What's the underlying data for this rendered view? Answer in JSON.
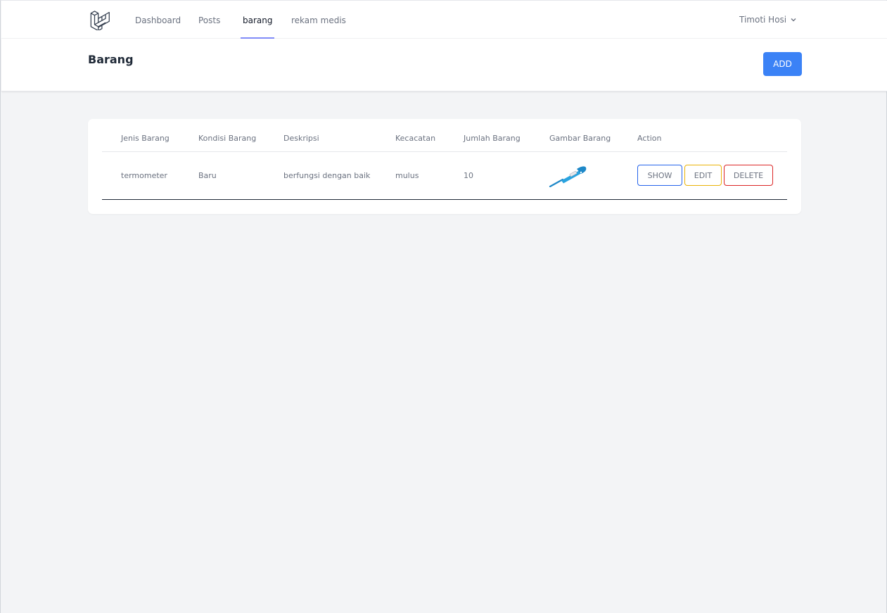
{
  "nav": {
    "logo_icon": "laravel-logo-icon",
    "links": [
      {
        "label": "Dashboard",
        "active": false
      },
      {
        "label": "Posts",
        "active": false
      },
      {
        "label": "barang",
        "active": true
      },
      {
        "label": "rekam medis",
        "active": false
      }
    ],
    "user_name": "Timoti Hosi",
    "user_menu_icon": "chevron-down-icon"
  },
  "header": {
    "title": "Barang",
    "add_label": "ADD"
  },
  "table": {
    "columns": [
      "Jenis Barang",
      "Kondisi Barang",
      "Deskripsi",
      "Kecacatan",
      "Jumlah Barang",
      "Gambar Barang",
      "Action"
    ],
    "rows": [
      {
        "jenis": "termometer",
        "kondisi": "Baru",
        "deskripsi": "berfungsi dengan baik",
        "kecacatan": "mulus",
        "jumlah": "10",
        "gambar_icon": "thermometer-image",
        "actions": {
          "show": "SHOW",
          "edit": "EDIT",
          "delete": "DELETE"
        }
      }
    ]
  },
  "colors": {
    "accent_blue": "#3b82f6",
    "active_underline": "#818cf8",
    "edit_border": "#eab308",
    "delete_border": "#dc2626",
    "background": "#f3f4f6"
  }
}
